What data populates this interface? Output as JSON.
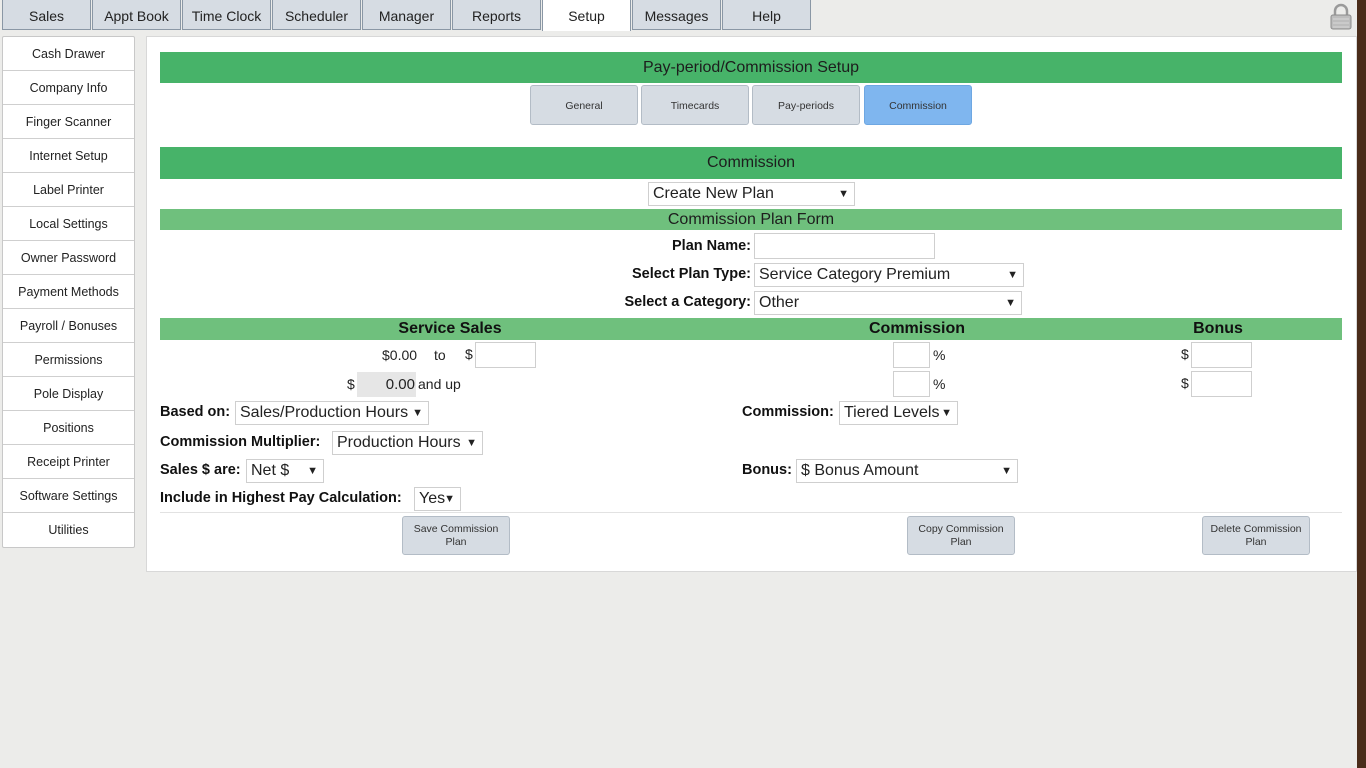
{
  "nav": {
    "tabs": [
      {
        "label": "Sales"
      },
      {
        "label": "Appt Book"
      },
      {
        "label": "Time Clock"
      },
      {
        "label": "Scheduler"
      },
      {
        "label": "Manager"
      },
      {
        "label": "Reports"
      },
      {
        "label": "Setup"
      },
      {
        "label": "Messages"
      },
      {
        "label": "Help"
      }
    ],
    "active_tab": "Setup"
  },
  "sidebar": {
    "items": [
      {
        "label": "Cash Drawer"
      },
      {
        "label": "Company Info"
      },
      {
        "label": "Finger Scanner"
      },
      {
        "label": "Internet Setup"
      },
      {
        "label": "Label Printer"
      },
      {
        "label": "Local Settings"
      },
      {
        "label": "Owner Password"
      },
      {
        "label": "Payment Methods"
      },
      {
        "label": "Payroll / Bonuses"
      },
      {
        "label": "Permissions"
      },
      {
        "label": "Pole Display"
      },
      {
        "label": "Positions"
      },
      {
        "label": "Receipt Printer"
      },
      {
        "label": "Software Settings"
      },
      {
        "label": "Utilities"
      }
    ]
  },
  "page": {
    "title": "Pay-period/Commission Setup",
    "subtabs": [
      {
        "label": "General"
      },
      {
        "label": "Timecards"
      },
      {
        "label": "Pay-periods"
      },
      {
        "label": "Commission"
      }
    ],
    "active_subtab": "Commission"
  },
  "commission": {
    "section_title": "Commission",
    "plan_select": "Create New Plan",
    "form_title": "Commission Plan Form",
    "plan_name_label": "Plan Name:",
    "plan_name_value": "",
    "plan_type_label": "Select Plan Type:",
    "plan_type_value": "Service Category Premium",
    "category_label": "Select a Category:",
    "category_value": "Other",
    "headers": {
      "service_sales": "Service Sales",
      "commission": "Commission",
      "bonus": "Bonus"
    },
    "tier1": {
      "from": "$0.00",
      "to_word": "to",
      "to_currency": "$",
      "to_value": "",
      "pct_value": "",
      "pct_symbol": "%",
      "bonus_currency": "$",
      "bonus_value": ""
    },
    "tier2": {
      "currency": "$",
      "from_value": "0.00",
      "and_up": "and up",
      "pct_value": "",
      "pct_symbol": "%",
      "bonus_currency": "$",
      "bonus_value": ""
    },
    "based_on_label": "Based on:",
    "based_on_value": "Sales/Production Hours",
    "commission_label": "Commission:",
    "commission_value": "Tiered Levels",
    "multiplier_label": "Commission Multiplier:",
    "multiplier_value": "Production Hours",
    "sales_are_label": "Sales $ are:",
    "sales_are_value": "Net $",
    "bonus_label": "Bonus:",
    "bonus_value": "$ Bonus Amount",
    "highest_pay_label": "Include in Highest Pay Calculation:",
    "highest_pay_value": "Yes",
    "buttons": {
      "save": "Save Commission Plan",
      "copy": "Copy Commission Plan",
      "delete": "Delete Commission Plan"
    }
  },
  "icons": {
    "lock": "lock-icon",
    "dropdown_arrow": "▼"
  },
  "colors": {
    "header_green": "#47b369",
    "light_green": "#6fc07d",
    "active_blue": "#7fb6ef",
    "tab_gray": "#d6dce3"
  }
}
